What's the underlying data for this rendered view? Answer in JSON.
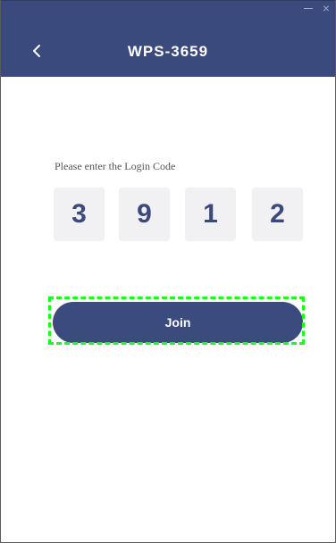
{
  "window": {
    "minimize_icon": "minimize-icon",
    "close_glyph": "×"
  },
  "header": {
    "title": "WPS-3659",
    "back_icon": "chevron-left-icon",
    "background_color": "#3a4a7c"
  },
  "login": {
    "prompt": "Please enter the Login Code",
    "code_digits": [
      "3",
      "9",
      "1",
      "2"
    ]
  },
  "join_button": {
    "label": "Join",
    "color": "#3b4b7d",
    "focus_outline_color": "#19ff19"
  }
}
